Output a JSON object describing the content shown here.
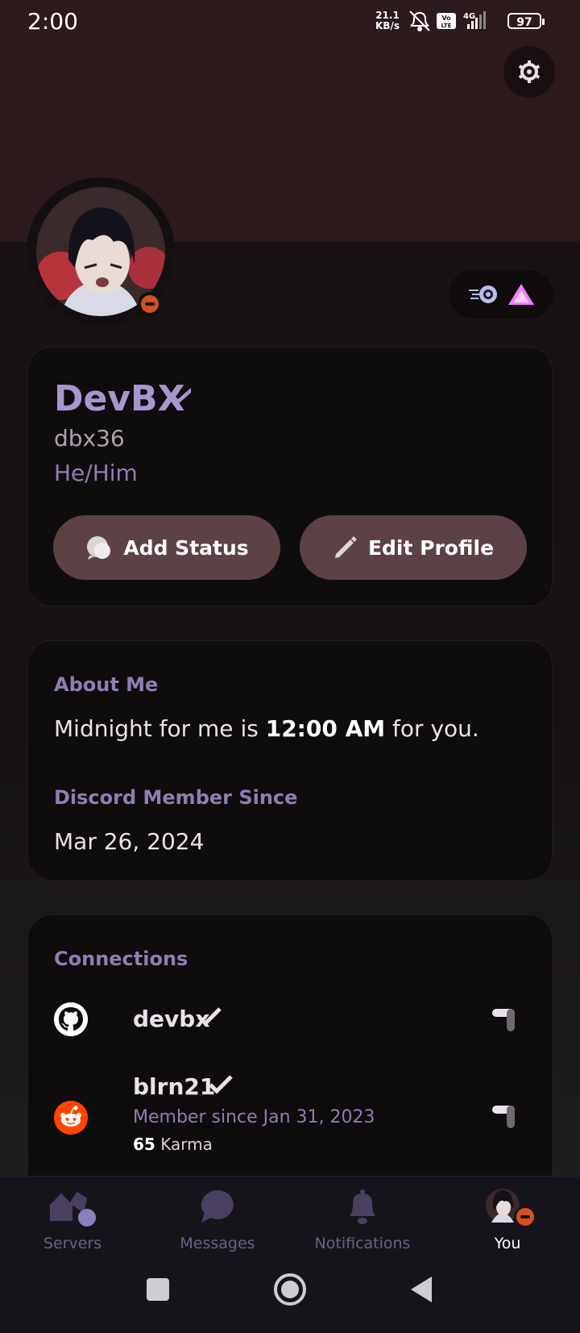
{
  "status_bar": {
    "time": "2:00",
    "speed_value": "21.1",
    "speed_unit": "KB/s",
    "network": "4G",
    "volte": "Vo LTE",
    "battery": "97"
  },
  "profile": {
    "display_name": "DevBX",
    "username": "dbx36",
    "pronouns": "He/Him",
    "status": "dnd",
    "buttons": {
      "add_status": "Add Status",
      "edit_profile": "Edit Profile"
    }
  },
  "about": {
    "label": "About Me",
    "text_before": "Midnight for me is ",
    "text_time": "12:00 AM",
    "text_after": " for you.",
    "member_since_label": "Discord Member Since",
    "member_since_date": "Mar 26, 2024"
  },
  "connections": {
    "label": "Connections",
    "items": [
      {
        "service": "github-icon",
        "name": "devbx",
        "verified": true
      },
      {
        "service": "reddit-icon",
        "name": "blrn21",
        "verified": true,
        "member_since": "Member since Jan 31, 2023",
        "karma_value": "65",
        "karma_label": " Karma"
      }
    ]
  },
  "nav": {
    "items": [
      {
        "label": "Servers",
        "icon": "servers-icon"
      },
      {
        "label": "Messages",
        "icon": "messages-icon"
      },
      {
        "label": "Notifications",
        "icon": "bell-icon"
      },
      {
        "label": "You",
        "icon": "avatar"
      }
    ],
    "active": "You"
  },
  "colors": {
    "accent": "#a797cf",
    "button": "#5c4244",
    "banner": "#2c1a1d",
    "dnd": "#d4521d"
  }
}
